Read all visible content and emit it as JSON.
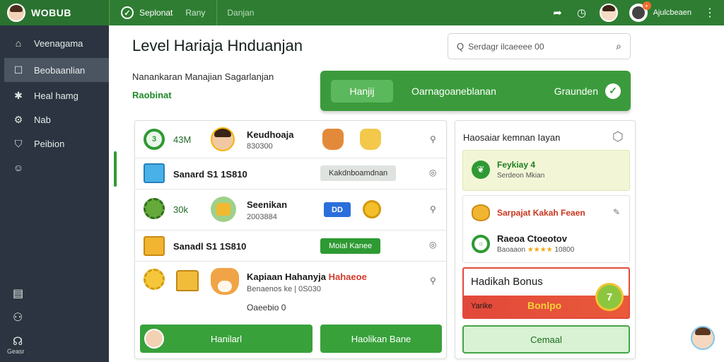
{
  "topbar": {
    "brand": "WOBUB",
    "status": "Seplonat",
    "status_extra": "Rany",
    "link": "Danjan",
    "user_name": "Ajulcbeaen",
    "notification_badge": "+"
  },
  "sidebar": {
    "items": [
      {
        "label": "Veenagama",
        "icon": "home-icon"
      },
      {
        "label": "Beobaanlian",
        "icon": "square-icon"
      },
      {
        "label": "Heal hamg",
        "icon": "settings-icon"
      },
      {
        "label": "Nab",
        "icon": "gear-icon"
      },
      {
        "label": "Peibion",
        "icon": "shield-icon"
      },
      {
        "label": "",
        "icon": "emoji-icon"
      }
    ],
    "bottom_label": "Geasr"
  },
  "main": {
    "title": "Level Hariaja Hnduanjan",
    "search_placeholder": "Serdagr ilcaeeee 00",
    "subtitle": "Nanankaran Manajian Sagarlanjan",
    "subtitle_green": "Raobinat",
    "banner": {
      "button": "Hanjij",
      "text": "Oarnagoaneblanan",
      "right": "Graunden"
    }
  },
  "list": {
    "rows": [
      {
        "stat": "43M",
        "ring": "3",
        "title": "Keudhoaja",
        "sub": "830300"
      },
      {
        "title": "Sanard S1 1S810",
        "tag": "Kakdnboamdnan"
      },
      {
        "stat": "30k",
        "title": "Seenikan",
        "sub": "2003884",
        "tag": "DD"
      },
      {
        "title": "Sanadl S1 1S810",
        "tag": "Moial  Kanee"
      },
      {
        "title_a": "Kapiaan Hahanyja ",
        "title_b": "Hahaeoe",
        "sub": "Benaenos ke | 0S030",
        "extra": "Oaeebio 0"
      }
    ],
    "buttons": [
      "Hanilarl",
      "Haolikan Bane"
    ]
  },
  "panel": {
    "title": "Haosaiar kemnan Iayan",
    "card1": {
      "title": "Feykiay 4",
      "sub": "Serdeon Mkian"
    },
    "card2": {
      "title": "Sarpajat Kakah Feaen",
      "title2": "Raeoa Ctoeotov",
      "sub": "Baoaaon",
      "stars": "★★★★",
      "points": "10800"
    },
    "bonus": {
      "title": "Hadikah Bonus",
      "left": "Yarike",
      "right": "Bonlpo",
      "medal": "7"
    },
    "button": "Cemaal"
  }
}
